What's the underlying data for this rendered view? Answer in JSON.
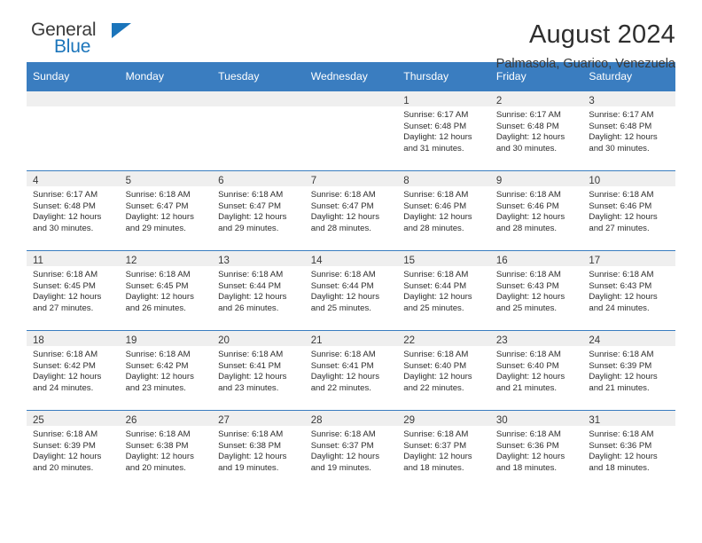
{
  "branding": {
    "logo_general": "General",
    "logo_blue": "Blue",
    "logo_triangle_color": "#1b75bb"
  },
  "header": {
    "title": "August 2024",
    "subtitle": "Palmasola, Guarico, Venezuela"
  },
  "colors": {
    "header_blue": "#3a7dc0",
    "daynum_band": "#efefef",
    "text_dark": "#2d2d2d"
  },
  "weekday_headers": [
    "Sunday",
    "Monday",
    "Tuesday",
    "Wednesday",
    "Thursday",
    "Friday",
    "Saturday"
  ],
  "weeks": [
    [
      {
        "day": "",
        "empty": true,
        "sunrise": "",
        "sunset": "",
        "daylight_line1": "",
        "daylight_line2": ""
      },
      {
        "day": "",
        "empty": true,
        "sunrise": "",
        "sunset": "",
        "daylight_line1": "",
        "daylight_line2": ""
      },
      {
        "day": "",
        "empty": true,
        "sunrise": "",
        "sunset": "",
        "daylight_line1": "",
        "daylight_line2": ""
      },
      {
        "day": "",
        "empty": true,
        "sunrise": "",
        "sunset": "",
        "daylight_line1": "",
        "daylight_line2": ""
      },
      {
        "day": "1",
        "empty": false,
        "sunrise": "Sunrise: 6:17 AM",
        "sunset": "Sunset: 6:48 PM",
        "daylight_line1": "Daylight: 12 hours",
        "daylight_line2": "and 31 minutes."
      },
      {
        "day": "2",
        "empty": false,
        "sunrise": "Sunrise: 6:17 AM",
        "sunset": "Sunset: 6:48 PM",
        "daylight_line1": "Daylight: 12 hours",
        "daylight_line2": "and 30 minutes."
      },
      {
        "day": "3",
        "empty": false,
        "sunrise": "Sunrise: 6:17 AM",
        "sunset": "Sunset: 6:48 PM",
        "daylight_line1": "Daylight: 12 hours",
        "daylight_line2": "and 30 minutes."
      }
    ],
    [
      {
        "day": "4",
        "empty": false,
        "sunrise": "Sunrise: 6:17 AM",
        "sunset": "Sunset: 6:48 PM",
        "daylight_line1": "Daylight: 12 hours",
        "daylight_line2": "and 30 minutes."
      },
      {
        "day": "5",
        "empty": false,
        "sunrise": "Sunrise: 6:18 AM",
        "sunset": "Sunset: 6:47 PM",
        "daylight_line1": "Daylight: 12 hours",
        "daylight_line2": "and 29 minutes."
      },
      {
        "day": "6",
        "empty": false,
        "sunrise": "Sunrise: 6:18 AM",
        "sunset": "Sunset: 6:47 PM",
        "daylight_line1": "Daylight: 12 hours",
        "daylight_line2": "and 29 minutes."
      },
      {
        "day": "7",
        "empty": false,
        "sunrise": "Sunrise: 6:18 AM",
        "sunset": "Sunset: 6:47 PM",
        "daylight_line1": "Daylight: 12 hours",
        "daylight_line2": "and 28 minutes."
      },
      {
        "day": "8",
        "empty": false,
        "sunrise": "Sunrise: 6:18 AM",
        "sunset": "Sunset: 6:46 PM",
        "daylight_line1": "Daylight: 12 hours",
        "daylight_line2": "and 28 minutes."
      },
      {
        "day": "9",
        "empty": false,
        "sunrise": "Sunrise: 6:18 AM",
        "sunset": "Sunset: 6:46 PM",
        "daylight_line1": "Daylight: 12 hours",
        "daylight_line2": "and 28 minutes."
      },
      {
        "day": "10",
        "empty": false,
        "sunrise": "Sunrise: 6:18 AM",
        "sunset": "Sunset: 6:46 PM",
        "daylight_line1": "Daylight: 12 hours",
        "daylight_line2": "and 27 minutes."
      }
    ],
    [
      {
        "day": "11",
        "empty": false,
        "sunrise": "Sunrise: 6:18 AM",
        "sunset": "Sunset: 6:45 PM",
        "daylight_line1": "Daylight: 12 hours",
        "daylight_line2": "and 27 minutes."
      },
      {
        "day": "12",
        "empty": false,
        "sunrise": "Sunrise: 6:18 AM",
        "sunset": "Sunset: 6:45 PM",
        "daylight_line1": "Daylight: 12 hours",
        "daylight_line2": "and 26 minutes."
      },
      {
        "day": "13",
        "empty": false,
        "sunrise": "Sunrise: 6:18 AM",
        "sunset": "Sunset: 6:44 PM",
        "daylight_line1": "Daylight: 12 hours",
        "daylight_line2": "and 26 minutes."
      },
      {
        "day": "14",
        "empty": false,
        "sunrise": "Sunrise: 6:18 AM",
        "sunset": "Sunset: 6:44 PM",
        "daylight_line1": "Daylight: 12 hours",
        "daylight_line2": "and 25 minutes."
      },
      {
        "day": "15",
        "empty": false,
        "sunrise": "Sunrise: 6:18 AM",
        "sunset": "Sunset: 6:44 PM",
        "daylight_line1": "Daylight: 12 hours",
        "daylight_line2": "and 25 minutes."
      },
      {
        "day": "16",
        "empty": false,
        "sunrise": "Sunrise: 6:18 AM",
        "sunset": "Sunset: 6:43 PM",
        "daylight_line1": "Daylight: 12 hours",
        "daylight_line2": "and 25 minutes."
      },
      {
        "day": "17",
        "empty": false,
        "sunrise": "Sunrise: 6:18 AM",
        "sunset": "Sunset: 6:43 PM",
        "daylight_line1": "Daylight: 12 hours",
        "daylight_line2": "and 24 minutes."
      }
    ],
    [
      {
        "day": "18",
        "empty": false,
        "sunrise": "Sunrise: 6:18 AM",
        "sunset": "Sunset: 6:42 PM",
        "daylight_line1": "Daylight: 12 hours",
        "daylight_line2": "and 24 minutes."
      },
      {
        "day": "19",
        "empty": false,
        "sunrise": "Sunrise: 6:18 AM",
        "sunset": "Sunset: 6:42 PM",
        "daylight_line1": "Daylight: 12 hours",
        "daylight_line2": "and 23 minutes."
      },
      {
        "day": "20",
        "empty": false,
        "sunrise": "Sunrise: 6:18 AM",
        "sunset": "Sunset: 6:41 PM",
        "daylight_line1": "Daylight: 12 hours",
        "daylight_line2": "and 23 minutes."
      },
      {
        "day": "21",
        "empty": false,
        "sunrise": "Sunrise: 6:18 AM",
        "sunset": "Sunset: 6:41 PM",
        "daylight_line1": "Daylight: 12 hours",
        "daylight_line2": "and 22 minutes."
      },
      {
        "day": "22",
        "empty": false,
        "sunrise": "Sunrise: 6:18 AM",
        "sunset": "Sunset: 6:40 PM",
        "daylight_line1": "Daylight: 12 hours",
        "daylight_line2": "and 22 minutes."
      },
      {
        "day": "23",
        "empty": false,
        "sunrise": "Sunrise: 6:18 AM",
        "sunset": "Sunset: 6:40 PM",
        "daylight_line1": "Daylight: 12 hours",
        "daylight_line2": "and 21 minutes."
      },
      {
        "day": "24",
        "empty": false,
        "sunrise": "Sunrise: 6:18 AM",
        "sunset": "Sunset: 6:39 PM",
        "daylight_line1": "Daylight: 12 hours",
        "daylight_line2": "and 21 minutes."
      }
    ],
    [
      {
        "day": "25",
        "empty": false,
        "sunrise": "Sunrise: 6:18 AM",
        "sunset": "Sunset: 6:39 PM",
        "daylight_line1": "Daylight: 12 hours",
        "daylight_line2": "and 20 minutes."
      },
      {
        "day": "26",
        "empty": false,
        "sunrise": "Sunrise: 6:18 AM",
        "sunset": "Sunset: 6:38 PM",
        "daylight_line1": "Daylight: 12 hours",
        "daylight_line2": "and 20 minutes."
      },
      {
        "day": "27",
        "empty": false,
        "sunrise": "Sunrise: 6:18 AM",
        "sunset": "Sunset: 6:38 PM",
        "daylight_line1": "Daylight: 12 hours",
        "daylight_line2": "and 19 minutes."
      },
      {
        "day": "28",
        "empty": false,
        "sunrise": "Sunrise: 6:18 AM",
        "sunset": "Sunset: 6:37 PM",
        "daylight_line1": "Daylight: 12 hours",
        "daylight_line2": "and 19 minutes."
      },
      {
        "day": "29",
        "empty": false,
        "sunrise": "Sunrise: 6:18 AM",
        "sunset": "Sunset: 6:37 PM",
        "daylight_line1": "Daylight: 12 hours",
        "daylight_line2": "and 18 minutes."
      },
      {
        "day": "30",
        "empty": false,
        "sunrise": "Sunrise: 6:18 AM",
        "sunset": "Sunset: 6:36 PM",
        "daylight_line1": "Daylight: 12 hours",
        "daylight_line2": "and 18 minutes."
      },
      {
        "day": "31",
        "empty": false,
        "sunrise": "Sunrise: 6:18 AM",
        "sunset": "Sunset: 6:36 PM",
        "daylight_line1": "Daylight: 12 hours",
        "daylight_line2": "and 18 minutes."
      }
    ]
  ]
}
